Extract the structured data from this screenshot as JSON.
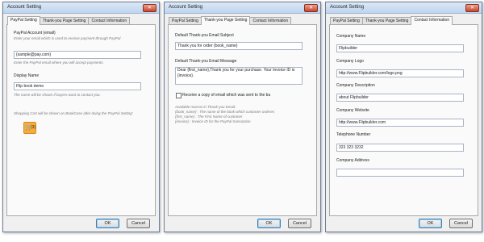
{
  "dialogs": [
    {
      "title": "Account Setting",
      "close_glyph": "✕",
      "tabs": [
        "PayPal Setting",
        "Thank-you Page Setting",
        "Contact Information"
      ],
      "active_tab": 0,
      "paypal_account_label": "PayPal Account (email)",
      "paypal_account_hint": "Enter your email which is used to receive payment through PayPal",
      "paypal_account_value": "{sample@pay.com}",
      "paypal_account_hint2": "Enter the PayPal email where you will accept payments.",
      "display_name_label": "Display Name",
      "display_name_value": "Flip book demo",
      "display_name_hint": "The name will be shown if buyers want to contact you.",
      "cart_hint": "Shopping Cart will be shown on BookCase after doing the 'PayPal Setting'",
      "cart_count": "(3)",
      "ok": "OK",
      "cancel": "Cancel"
    },
    {
      "title": "Account Setting",
      "close_glyph": "✕",
      "tabs": [
        "PayPal Setting",
        "Thank-you Page Setting",
        "Contact Information"
      ],
      "active_tab": 1,
      "subject_label": "Default Thank-you Email Subject",
      "subject_value": "Thank you for order {book_name}",
      "message_label": "Default Thank-you Email Message",
      "message_line1": "Dear {first_name},Thank you for your purchase. Your Invoice ID is",
      "message_line2": "{invoice}.",
      "copy_label": "Receive a copy of email which was sent to the bu",
      "macros_title": "Available macros in Thank-you Email:",
      "macro1": "{book_name} : The name of the book which customer orderes",
      "macro2": "{first_name} : The First Name of customer",
      "macro3": "{invoice} : Invoice ID for the PayPal transaction",
      "ok": "OK",
      "cancel": "Cancel"
    },
    {
      "title": "Account Setting",
      "close_glyph": "✕",
      "tabs": [
        "PayPal Setting",
        "Thank-you Page Setting",
        "Contact Information"
      ],
      "active_tab": 2,
      "company_name_label": "Company Name",
      "company_name_value": "Flipbuilder",
      "company_logo_label": "Company Logo",
      "company_logo_value": "http://www.Flipbuilder.com/logo.png",
      "company_desc_label": "Company Description",
      "company_desc_value": "about Flipbuilder",
      "company_website_label": "Company Website",
      "company_website_value": "http://www.Flipbuilder.com",
      "telephone_label": "Telephone Number",
      "telephone_value": "323 323 3232",
      "address_label": "Company Address",
      "address_value": "",
      "ok": "OK",
      "cancel": "Cancel"
    }
  ],
  "colors": {
    "title_bar": "#c9dbf1",
    "close_button": "#c7452c",
    "cart_button": "#f6ad3c",
    "ok_focus": "#3c7fb1"
  },
  "icons": {
    "close": "close-icon",
    "cart": "shopping-cart-icon",
    "checkbox": "checkbox-icon"
  }
}
